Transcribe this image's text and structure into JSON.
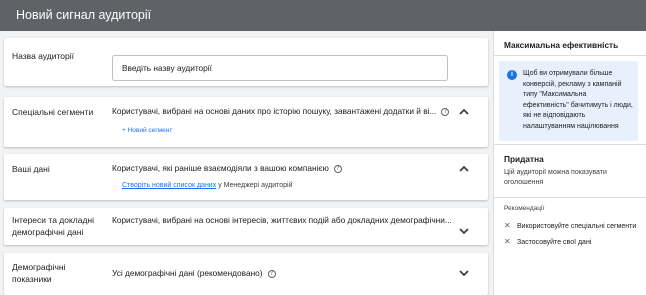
{
  "header": {
    "title": "Новий сигнал аудиторії"
  },
  "form": {
    "name": {
      "label": "Назва аудиторії",
      "placeholder": "Введіть назву аудиторії",
      "value": ""
    },
    "custom_segments": {
      "label": "Спеціальні сегменти",
      "description": "Користувачі, вибрані на основі даних про історію пошуку, завантажені додатки й ві...",
      "new_segment": "+ Новий сегмент"
    },
    "your_data": {
      "label": "Ваші дані",
      "description": "Користувачі, які раніше взаємодіяли з вашою компанією",
      "link": "Створіть новий список даних",
      "link_suffix": " у Менеджері аудиторій"
    },
    "interests": {
      "label_line1": "Інтереси та докладні",
      "label_line2": "демографічні дані",
      "description": "Користувачі, вибрані на основі інтересів, життєвих подій або докладних демографічни..."
    },
    "demographics": {
      "label_line1": "Демографічні",
      "label_line2": "показники",
      "description": "Усі демографічні дані (рекомендовано)"
    }
  },
  "sidebar": {
    "title": "Максимальна ефективність",
    "info_text": "Щоб ви отримували більше конверсій, рекламу з кампаній типу \"Максимальна ефективність\" бачитимуть і люди, які не відповідають налаштуванням націлювання",
    "status_title": "Придатна",
    "status_text": "Цій аудиторії можна показувати оголошення",
    "recommendations_title": "Рекомендації",
    "recommendations": [
      "Використовуйте спеціальні сегменти",
      "Застосовуйте свої дані"
    ]
  },
  "colors": {
    "header_bg": "#5f6368",
    "link": "#1a73e8",
    "info_bg": "#e8f0fe"
  },
  "icons": {
    "help": "question-circle-icon",
    "expand": "chevron-down-icon",
    "collapse": "chevron-up-icon",
    "info": "info-circle-icon",
    "remove": "x-icon"
  }
}
